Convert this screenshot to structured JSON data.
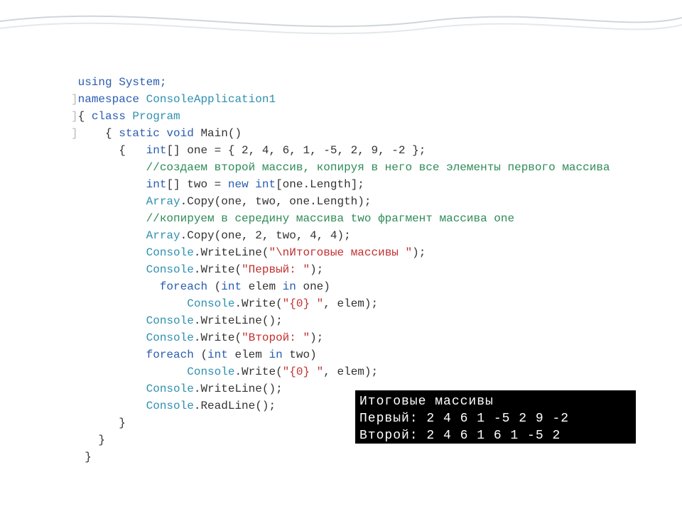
{
  "code": {
    "l1": " using System;",
    "l2a": "namespace",
    "l2b": " ConsoleApplication1",
    "l3a": "{ ",
    "l3b": "class",
    "l3c": " Program",
    "l4a": "    { ",
    "l4b": "static void",
    "l4c": " Main()",
    "l5a": "       {   ",
    "l5b": "int",
    "l5c": "[] one = { 2, 4, 6, 1, -5, 2, 9, -2 };",
    "l6": "           //создаем второй массив, копируя в него все элементы первого массива",
    "l7a": "           ",
    "l7b": "int",
    "l7c": "[] two = ",
    "l7d": "new int",
    "l7e": "[one.Length];",
    "l8a": "           ",
    "l8b": "Array",
    "l8c": ".Copy(one, two, one.Length);",
    "l9": "           //копируем в середину массива two фрагмент массива one",
    "l10a": "           ",
    "l10b": "Array",
    "l10c": ".Copy(one, 2, two, 4, 4);",
    "l11a": "           ",
    "l11b": "Console",
    "l11c": ".WriteLine(",
    "l11d": "\"\\nИтоговые массивы \"",
    "l11e": ");",
    "l12a": "           ",
    "l12b": "Console",
    "l12c": ".Write(",
    "l12d": "\"Первый: \"",
    "l12e": ");",
    "l13a": "             ",
    "l13b": "foreach",
    "l13c": " (",
    "l13d": "int",
    "l13e": " elem ",
    "l13f": "in",
    "l13g": " one)",
    "l14a": "                 ",
    "l14b": "Console",
    "l14c": ".Write(",
    "l14d": "\"{0} \"",
    "l14e": ", elem);",
    "l15a": "           ",
    "l15b": "Console",
    "l15c": ".WriteLine();",
    "l16a": "           ",
    "l16b": "Console",
    "l16c": ".Write(",
    "l16d": "\"Второй: \"",
    "l16e": ");",
    "l17a": "           ",
    "l17b": "foreach",
    "l17c": " (",
    "l17d": "int",
    "l17e": " elem ",
    "l17f": "in",
    "l17g": " two)",
    "l18a": "                 ",
    "l18b": "Console",
    "l18c": ".Write(",
    "l18d": "\"{0} \"",
    "l18e": ", elem);",
    "l19a": "           ",
    "l19b": "Console",
    "l19c": ".WriteLine();",
    "l20a": "           ",
    "l20b": "Console",
    "l20c": ".ReadLine();",
    "l21": "       }",
    "l22": "    }",
    "l23": "}"
  },
  "console": {
    "line1": "Итоговые массивы",
    "line2": "Первый: 2 4 6 1 -5 2 9 -2",
    "line3": "Второй: 2 4 6 1 6 1 -5 2"
  },
  "chart_data": null
}
